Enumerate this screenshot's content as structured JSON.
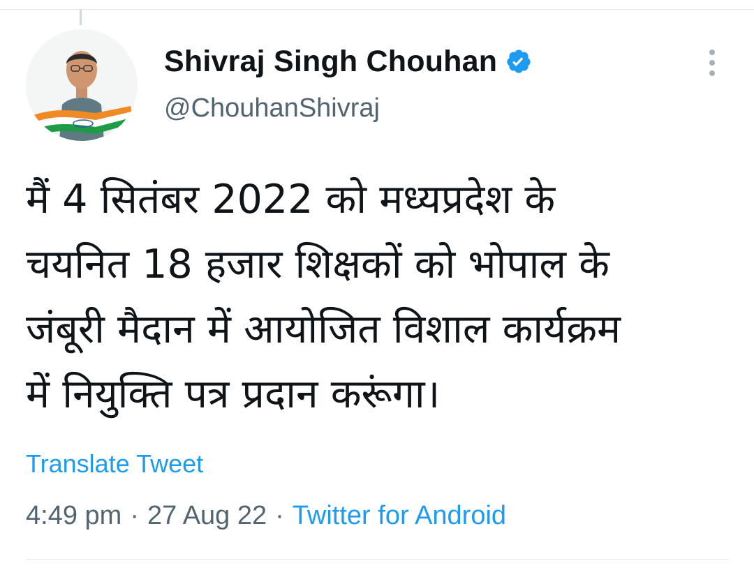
{
  "tweet": {
    "author": {
      "display_name": "Shivraj Singh Chouhan",
      "handle": "@ChouhanShivraj",
      "verified": true,
      "avatar_icon": "profile-photo"
    },
    "text": "मैं 4 सितंबर 2022 को मध्यप्रदेश के\nचयनित 18 हजार शिक्षकों को भोपाल के\nजंबूरी मैदान में आयोजित विशाल कार्यक्रम\nमें नियुक्ति पत्र प्रदान करूंगा।",
    "translate_label": "Translate Tweet",
    "time": "4:49 pm",
    "separator": "·",
    "date": "27 Aug 22",
    "source": "Twitter for Android",
    "more_icon": "more-vertical-icon"
  },
  "colors": {
    "link": "#1d9bf0",
    "secondary_text": "#536471",
    "primary_text": "#0f1419",
    "verified_badge": "#1d9bf0",
    "divider": "#e3e7ea"
  }
}
